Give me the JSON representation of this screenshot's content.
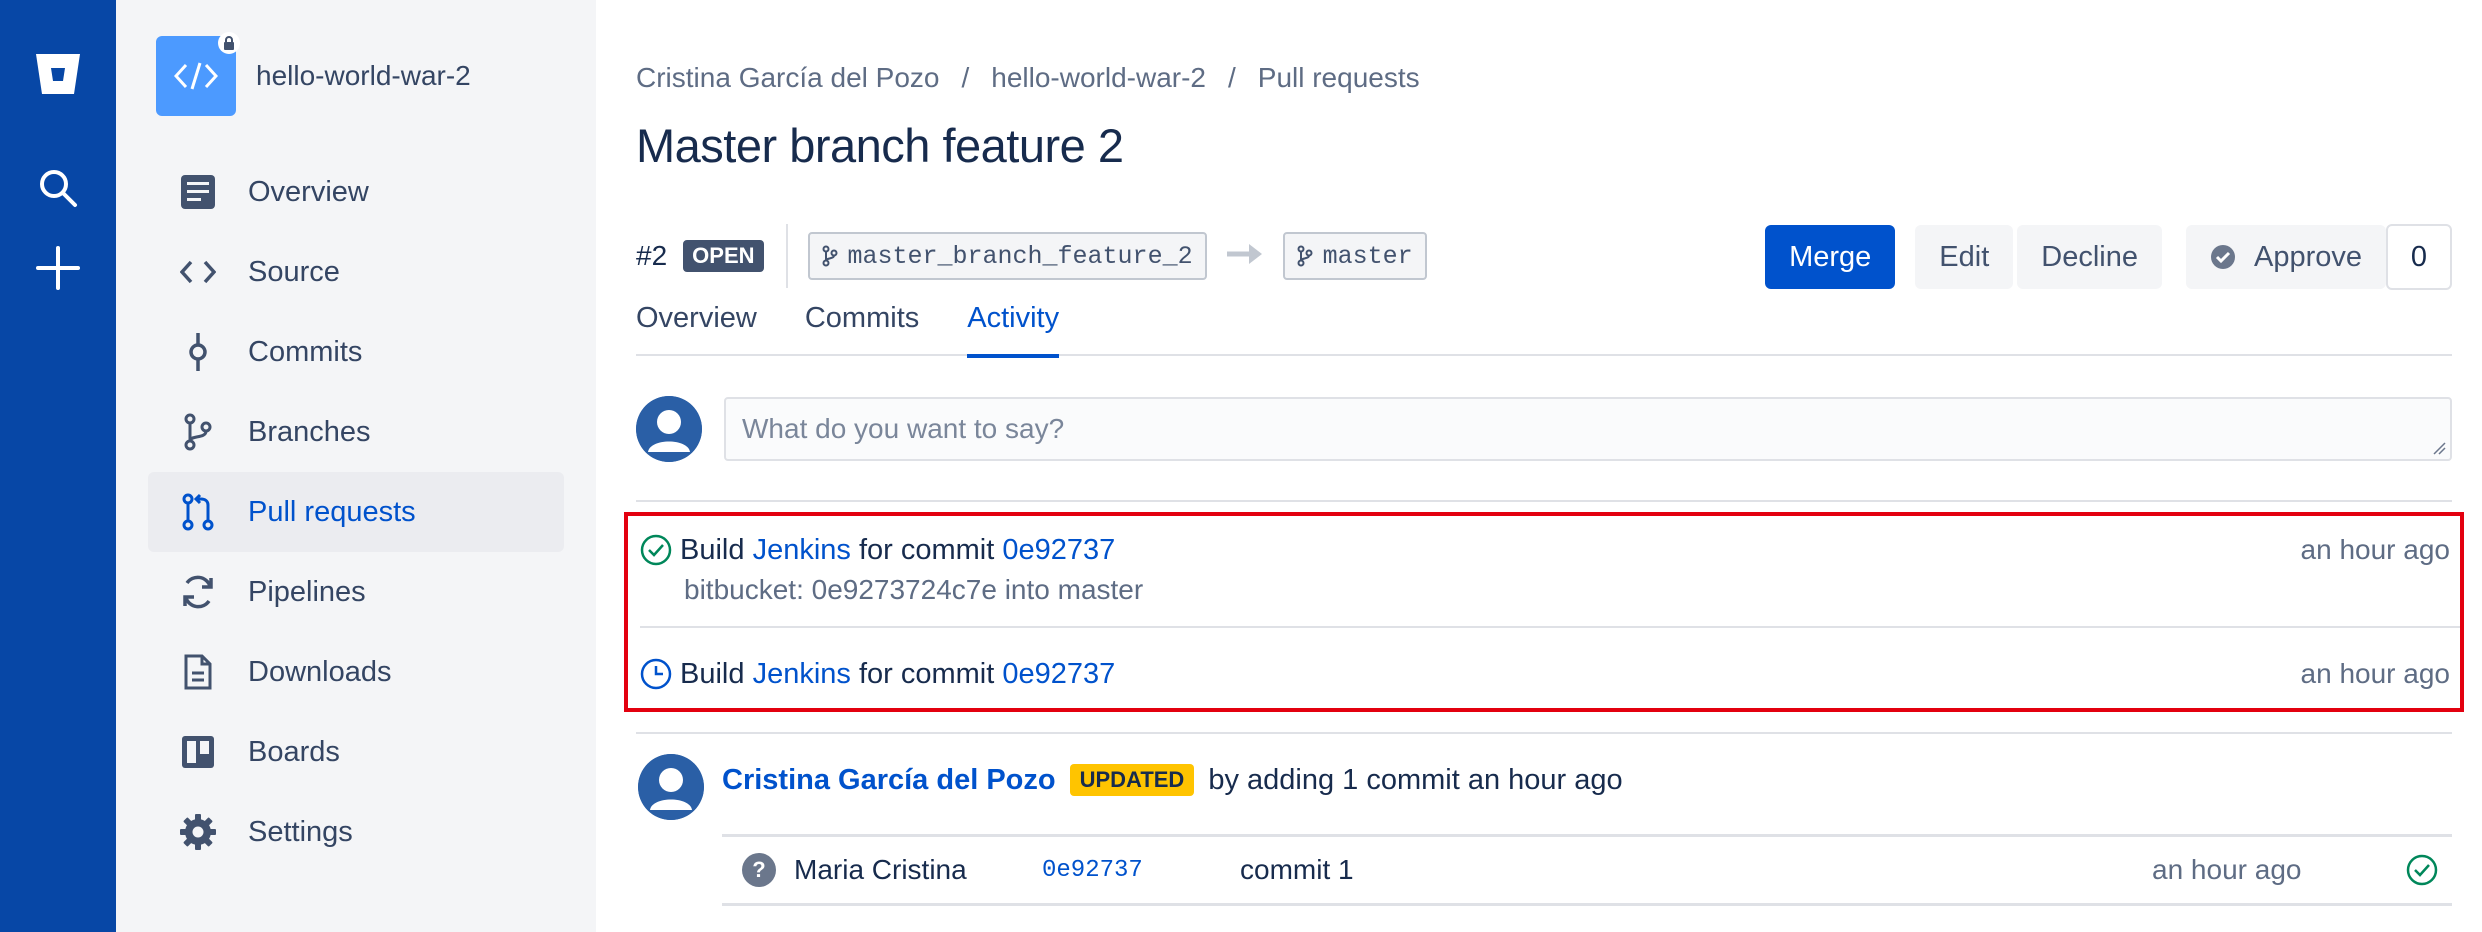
{
  "repo": {
    "name": "hello-world-war-2"
  },
  "sidebar": {
    "items": [
      {
        "label": "Overview",
        "icon": "overview-icon"
      },
      {
        "label": "Source",
        "icon": "source-code-icon"
      },
      {
        "label": "Commits",
        "icon": "commit-icon"
      },
      {
        "label": "Branches",
        "icon": "branch-icon"
      },
      {
        "label": "Pull requests",
        "icon": "pull-request-icon",
        "active": true
      },
      {
        "label": "Pipelines",
        "icon": "pipelines-icon"
      },
      {
        "label": "Downloads",
        "icon": "document-icon"
      },
      {
        "label": "Boards",
        "icon": "board-icon"
      },
      {
        "label": "Settings",
        "icon": "gear-icon"
      }
    ]
  },
  "breadcrumb": {
    "owner": "Cristina García del Pozo",
    "repo": "hello-world-war-2",
    "section": "Pull requests",
    "separator": "/"
  },
  "pr": {
    "title": "Master branch feature 2",
    "number": "#2",
    "state": "OPEN",
    "source_branch": "master_branch_feature_2",
    "target_branch": "master"
  },
  "actions": {
    "merge": "Merge",
    "edit": "Edit",
    "decline": "Decline",
    "approve": "Approve",
    "approve_count": "0"
  },
  "tabs": [
    "Overview",
    "Commits",
    "Activity"
  ],
  "comment": {
    "placeholder": "What do you want to say?"
  },
  "builds": [
    {
      "prefix": "Build",
      "tool": "Jenkins",
      "middle": "for commit",
      "hash": "0e92737",
      "description": "bitbucket: 0e9273724c7e into master",
      "time": "an hour ago",
      "status": "success"
    },
    {
      "prefix": "Build",
      "tool": "Jenkins",
      "middle": "for commit",
      "hash": "0e92737",
      "time": "an hour ago",
      "status": "in-progress"
    }
  ],
  "update": {
    "user": "Cristina García del Pozo",
    "badge": "UPDATED",
    "text": "by adding 1 commit an hour ago",
    "commit": {
      "author": "Maria Cristina",
      "hash": "0e92737",
      "message": "commit 1",
      "time": "an hour ago",
      "unknown_user_mark": "?"
    }
  },
  "colors": {
    "global_nav": "#0747a6",
    "primary": "#0052cc",
    "success": "#00875a",
    "highlight_box": "#e3000f",
    "updated_badge": "#ffc400"
  }
}
